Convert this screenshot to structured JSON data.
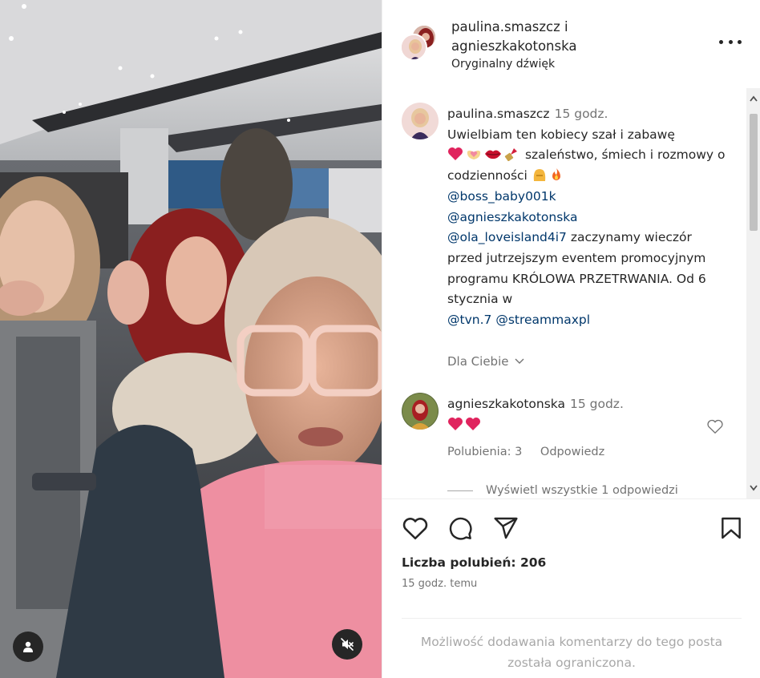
{
  "media": {
    "tag_icon": "person-tag-icon",
    "mute_icon": "speaker-muted-icon"
  },
  "header": {
    "username_line1": "paulina.smaszcz i",
    "username_line2": "agnieszkakotonska",
    "audio": "Oryginalny dźwięk",
    "more_icon": "more-options-icon"
  },
  "caption": {
    "username": "paulina.smaszcz",
    "time": "15 godz.",
    "text_part1": "Uwielbiam ten kobiecy szał i zabawę",
    "text_part2": "szaleństwo, śmiech i rozmowy o codzienności",
    "mention1": "@boss_baby001k",
    "mention2": "@agnieszkakotonska",
    "mention3": "@ola_loveisland4i7",
    "text_part3": "zaczynamy wieczór przed jutrzejszym eventem promocyjnym programu KRÓLOWA PRZETRWANIA. Od 6 stycznia w",
    "mention4": "@tvn.7",
    "mention5": "@streammaxpl",
    "translation": "Dla Ciebie",
    "emojis": [
      "red-heart",
      "pink-hands-heart",
      "lips",
      "lipstick",
      "fist-hands",
      "fire"
    ]
  },
  "comment": {
    "username": "agnieszkakotonska",
    "time": "15 godz.",
    "emojis": [
      "red-heart",
      "red-heart"
    ],
    "likes": "Polubienia: 3",
    "reply": "Odpowiedz",
    "view_replies": "Wyświetl wszystkie 1 odpowiedzi"
  },
  "actions": {
    "like_icon": "heart-icon",
    "comment_icon": "comment-icon",
    "share_icon": "share-icon",
    "save_icon": "bookmark-icon",
    "likes": "Liczba polubień: 206",
    "time": "15 godz. temu",
    "restricted": "Możliwość dodawania komentarzy do tego posta została ograniczona."
  },
  "colors": {
    "text": "#262626",
    "secondary": "#737373",
    "link": "#00376b",
    "heart": "#e0245e"
  }
}
